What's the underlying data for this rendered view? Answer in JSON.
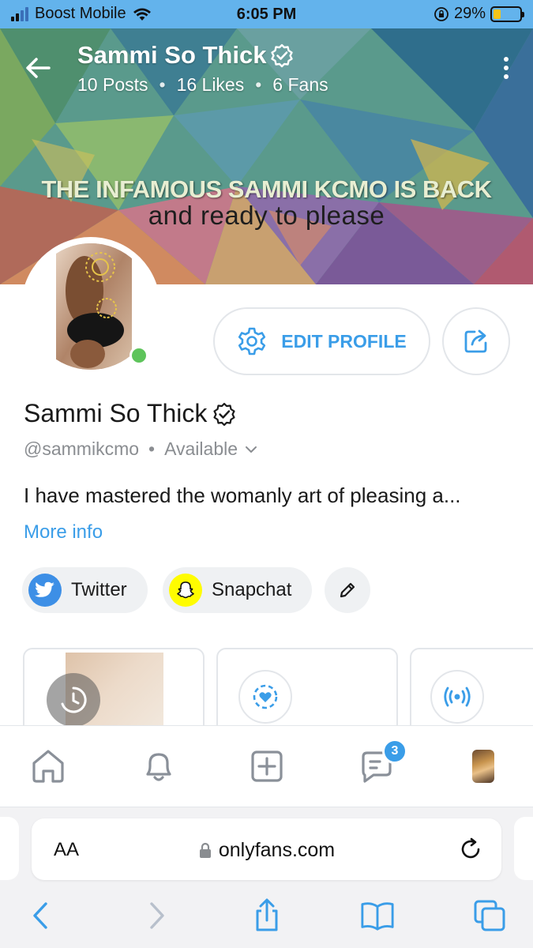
{
  "status_bar": {
    "carrier": "Boost Mobile",
    "time": "6:05 PM",
    "battery": "29%"
  },
  "header": {
    "title": "Sammi So Thick",
    "stats": {
      "posts": "10 Posts",
      "likes": "16 Likes",
      "fans": "6 Fans"
    }
  },
  "cover": {
    "line1": "THE INFAMOUS SAMMI KCMO IS BACK",
    "line2": "and ready to please"
  },
  "actions": {
    "edit_profile": "EDIT PROFILE"
  },
  "profile": {
    "name": "Sammi So Thick",
    "handle": "@sammikcmo",
    "availability": "Available",
    "bio": "I have mastered the womanly art of pleasing a...",
    "more_info": "More info"
  },
  "socials": [
    {
      "label": "Twitter",
      "icon": "twitter-bird-icon"
    },
    {
      "label": "Snapchat",
      "icon": "snapchat-ghost-icon"
    }
  ],
  "bottom_nav": {
    "messages_badge": "3",
    "items": [
      "home-icon",
      "bell-icon",
      "add-post-icon",
      "messages-icon",
      "avatar"
    ]
  },
  "browser": {
    "text_size_label": "AA",
    "url": "onlyfans.com"
  },
  "colors": {
    "accent": "#3a9de8",
    "status_bar": "#63b3ec",
    "online": "#5ec45b",
    "snapchat": "#fffc00",
    "twitter": "#1d9bf0"
  }
}
